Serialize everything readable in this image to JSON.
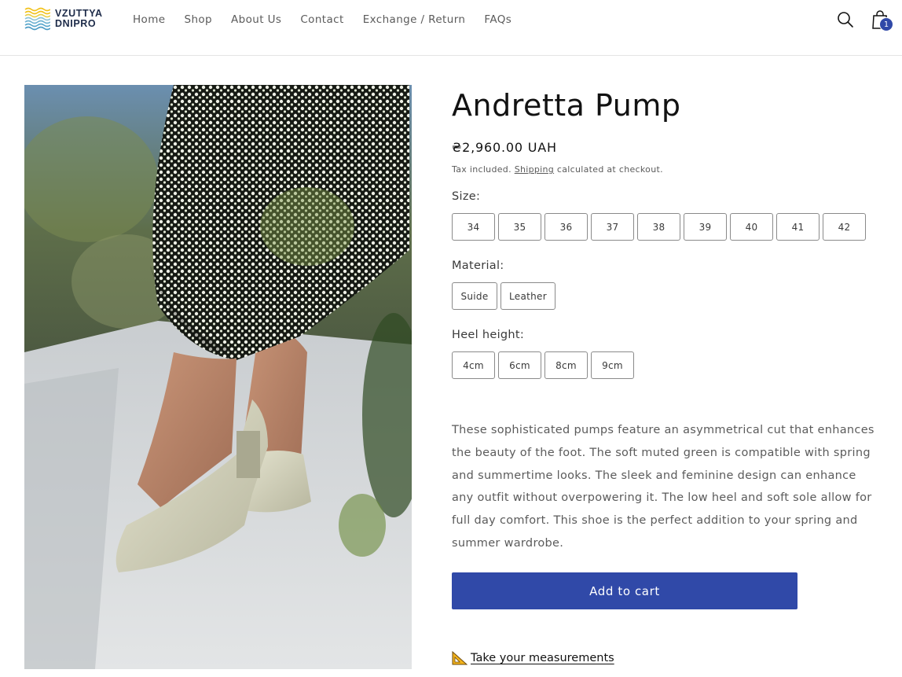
{
  "brand": {
    "logo_line1": "VZUTTYA",
    "logo_line2": "DNIPRO",
    "logo_icon": "wave-logo-icon"
  },
  "nav": {
    "items": [
      "Home",
      "Shop",
      "About Us",
      "Contact",
      "Exchange / Return",
      "FAQs"
    ]
  },
  "header_actions": {
    "search_icon": "search-icon",
    "cart_icon": "shopping-bag-icon",
    "cart_count": "1"
  },
  "product": {
    "title": "Andretta Pump",
    "price": "₴2,960.00 UAH",
    "tax_prefix": "Tax included. ",
    "tax_link": "Shipping",
    "tax_suffix": " calculated at checkout.",
    "size_label": "Size:",
    "sizes": [
      "34",
      "35",
      "36",
      "37",
      "38",
      "39",
      "40",
      "41",
      "42"
    ],
    "material_label": "Material:",
    "materials": [
      "Suide",
      "Leather"
    ],
    "heel_label": "Heel height:",
    "heels": [
      "4cm",
      "6cm",
      "8cm",
      "9cm"
    ],
    "description": "These sophisticated pumps feature an asymmetrical cut that enhances the beauty of the foot. The soft muted green is compatible with spring and summertime looks. The sleek and feminine design can enhance any outfit without overpowering it. The low heel and soft sole allow for full day comfort. This shoe is the perfect addition to your spring and summer wardrobe.",
    "add_to_cart": "Add to cart",
    "measure_link": "Take your measurements",
    "measure_icon": "ruler-triangle-icon"
  },
  "colors": {
    "accent": "#3049a8",
    "text": "#121212",
    "muted": "#5b5b5b"
  }
}
